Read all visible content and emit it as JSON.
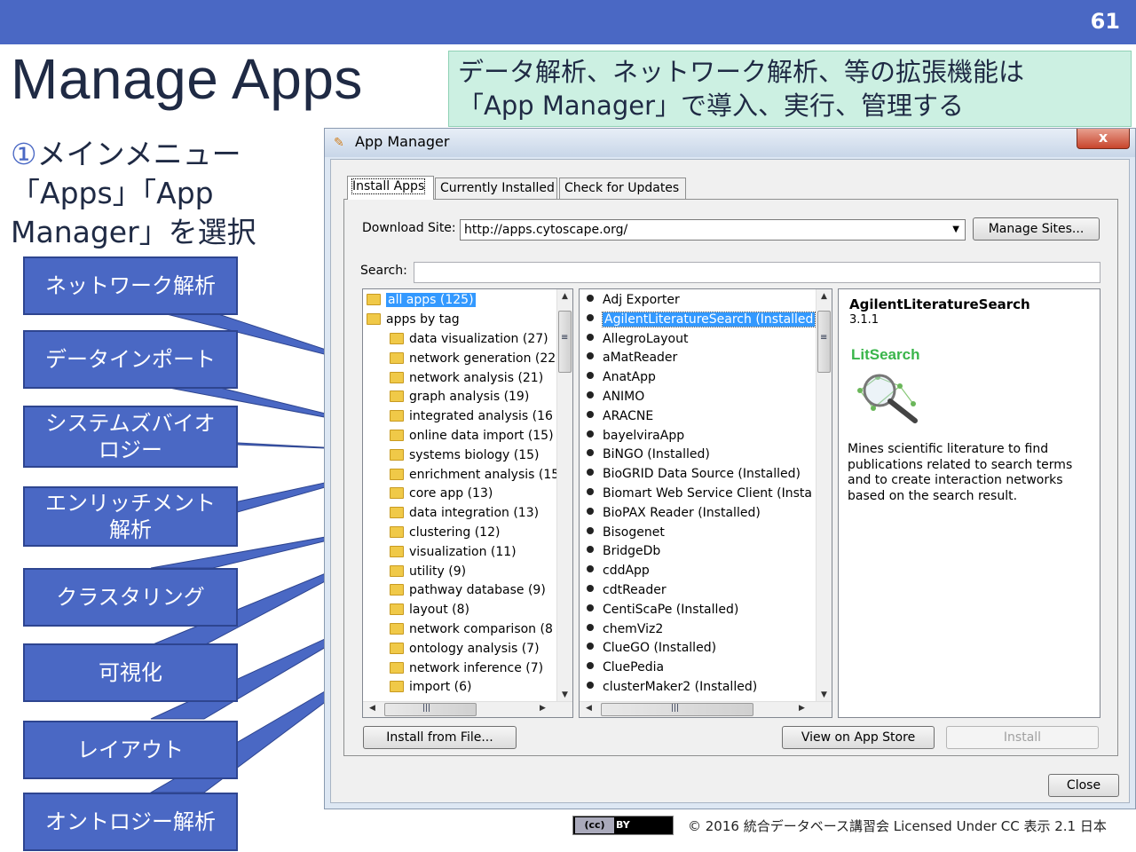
{
  "slide": {
    "page_number": "61",
    "title": "Manage Apps",
    "callout": "データ解析、ネットワーク解析、等の拡張機能は\n「App Manager」で導入、実行、管理する",
    "instruction_num": "①",
    "instruction": "メインメニュー\n「Apps」「App\nManager」を選択",
    "tags": [
      "ネットワーク解析",
      "データインポート",
      "システムズバイオ\nロジー",
      "エンリッチメント\n解析",
      "クラスタリング",
      "可視化",
      "レイアウト",
      "オントロジー解析"
    ],
    "footer": "© 2016  統合データベース講習会 Licensed Under CC 表示 2.1 日本",
    "cc_left": "(cc)",
    "cc_right": "BY"
  },
  "window": {
    "title": "App Manager",
    "close": "x",
    "tabs": [
      "Install Apps",
      "Currently Installed",
      "Check for Updates"
    ],
    "download_site_label": "Download Site:",
    "download_site_value": "http://apps.cytoscape.org/",
    "manage_sites": "Manage Sites...",
    "search_label": "Search:",
    "search_value": "",
    "tree_all": "all apps (125)",
    "tree_by_tag": "apps by tag",
    "tree_tags": [
      "data visualization (27)",
      "network generation (22",
      "network analysis (21)",
      "graph analysis (19)",
      "integrated analysis (16",
      "online data import (15)",
      "systems biology (15)",
      "enrichment analysis (15",
      "core app (13)",
      "data integration (13)",
      "clustering (12)",
      "visualization (11)",
      "utility (9)",
      "pathway database (9)",
      "layout (8)",
      "network comparison (8",
      "ontology analysis (7)",
      "network inference (7)",
      "import (6)"
    ],
    "apps": [
      "Adj Exporter",
      "AgilentLiteratureSearch (Installed",
      "AllegroLayout",
      "aMatReader",
      "AnatApp",
      "ANIMO",
      "ARACNE",
      "bayelviraApp",
      "BiNGO (Installed)",
      "BioGRID Data Source (Installed)",
      "Biomart Web Service Client (Insta",
      "BioPAX Reader (Installed)",
      "Bisogenet",
      "BridgeDb",
      "cddApp",
      "cdtReader",
      "CentiScaPe (Installed)",
      "chemViz2",
      "ClueGO (Installed)",
      "CluePedia",
      "clusterMaker2 (Installed)"
    ],
    "selected_app": 1,
    "detail": {
      "name": "AgilentLiteratureSearch",
      "version": "3.1.1",
      "logo_text": "LitSearch",
      "description": "Mines scientific literature to find publications related to search terms and to create interaction networks based on the search result."
    },
    "buttons": {
      "install_from_file": "Install from File...",
      "view_on_store": "View on App Store",
      "install": "Install",
      "close": "Close"
    },
    "scroll_marks": {
      "up": "▲",
      "down": "▼",
      "left": "◀",
      "right": "▶",
      "grip": "≡",
      "hgrip": "|||"
    }
  },
  "colors": {
    "accent": "#4a68c4",
    "callout_bg": "#ccf0e2",
    "selection": "#3399ff"
  }
}
